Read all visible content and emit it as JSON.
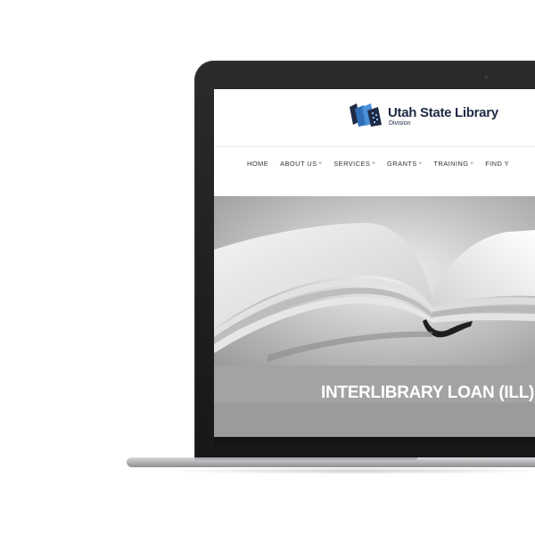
{
  "site": {
    "logo_title": "Utah State Library",
    "logo_subtitle": "Division"
  },
  "nav": {
    "items": [
      {
        "label": "HOME",
        "has_dropdown": false
      },
      {
        "label": "ABOUT US",
        "has_dropdown": true
      },
      {
        "label": "SERVICES",
        "has_dropdown": true
      },
      {
        "label": "GRANTS",
        "has_dropdown": true
      },
      {
        "label": "TRAINING",
        "has_dropdown": true
      },
      {
        "label": "FIND Y",
        "has_dropdown": false
      }
    ],
    "dropdown_glyph": "»"
  },
  "hero": {
    "image": "open-book-photo",
    "page_title": "INTERLIBRARY LOAN (ILL)"
  },
  "colors": {
    "logo_blue": "#2f6db5",
    "logo_dark": "#1f2a44",
    "title_band": "#a3a3a3",
    "laptop_bezel": "#1c1c1c"
  }
}
